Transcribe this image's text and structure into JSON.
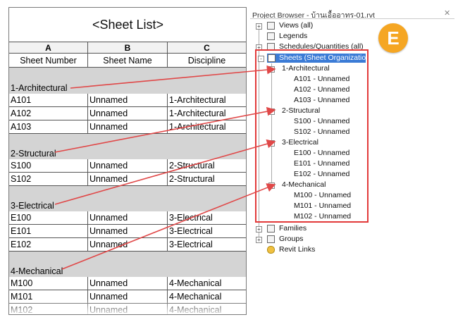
{
  "schedule": {
    "title": "<Sheet List>",
    "columns": [
      {
        "letter": "A",
        "name": "Sheet Number"
      },
      {
        "letter": "B",
        "name": "Sheet Name"
      },
      {
        "letter": "C",
        "name": "Discipline"
      }
    ],
    "groups": [
      {
        "label": "1-Architectural",
        "rows": [
          [
            "A101",
            "Unnamed",
            "1-Architectural"
          ],
          [
            "A102",
            "Unnamed",
            "1-Architectural"
          ],
          [
            "A103",
            "Unnamed",
            "1-Architectural"
          ]
        ]
      },
      {
        "label": "2-Structural",
        "rows": [
          [
            "S100",
            "Unnamed",
            "2-Structural"
          ],
          [
            "S102",
            "Unnamed",
            "2-Structural"
          ]
        ]
      },
      {
        "label": "3-Electrical",
        "rows": [
          [
            "E100",
            "Unnamed",
            "3-Electrical"
          ],
          [
            "E101",
            "Unnamed",
            "3-Electrical"
          ],
          [
            "E102",
            "Unnamed",
            "3-Electrical"
          ]
        ]
      },
      {
        "label": "4-Mechanical",
        "rows": [
          [
            "M100",
            "Unnamed",
            "4-Mechanical"
          ],
          [
            "M101",
            "Unnamed",
            "4-Mechanical"
          ],
          [
            "M102",
            "Unnamed",
            "4-Mechanical"
          ]
        ]
      }
    ]
  },
  "browser": {
    "title": "Project Browser - บ้านเอื้ออาทร-01.rvt",
    "close_icon": "close-icon",
    "top_nodes": [
      {
        "label": "Views (all)",
        "icon": "views-icon",
        "expander": "+"
      },
      {
        "label": "Legends",
        "icon": "legends-icon",
        "expander": ""
      },
      {
        "label": "Schedules/Quantities (all)",
        "icon": "schedules-icon",
        "expander": "+"
      }
    ],
    "sheets_node": {
      "label": "Sheets (Sheet Organization)",
      "icon": "sheets-icon",
      "expander": "-"
    },
    "sheet_groups": [
      {
        "label": "1-Architectural",
        "expander": "-",
        "items": [
          "A101 - Unnamed",
          "A102 - Unnamed",
          "A103 - Unnamed"
        ]
      },
      {
        "label": "2-Structural",
        "expander": "-",
        "items": [
          "S100 - Unnamed",
          "S102 - Unnamed"
        ]
      },
      {
        "label": "3-Electrical",
        "expander": "-",
        "items": [
          "E100 - Unnamed",
          "E101 - Unnamed",
          "E102 - Unnamed"
        ]
      },
      {
        "label": "4-Mechanical",
        "expander": "-",
        "items": [
          "M100 - Unnamed",
          "M101 - Unnamed",
          "M102 - Unnamed"
        ]
      }
    ],
    "bottom_nodes": [
      {
        "label": "Families",
        "icon": "families-icon",
        "expander": "+"
      },
      {
        "label": "Groups",
        "icon": "groups-icon",
        "expander": "+"
      },
      {
        "label": "Revit Links",
        "icon": "link-icon",
        "expander": ""
      }
    ]
  },
  "badge": {
    "letter": "E",
    "color": "#f5a623"
  },
  "colors": {
    "highlight": "#e23a3a",
    "selection": "#3b7bd6",
    "arrow": "#e04848"
  }
}
